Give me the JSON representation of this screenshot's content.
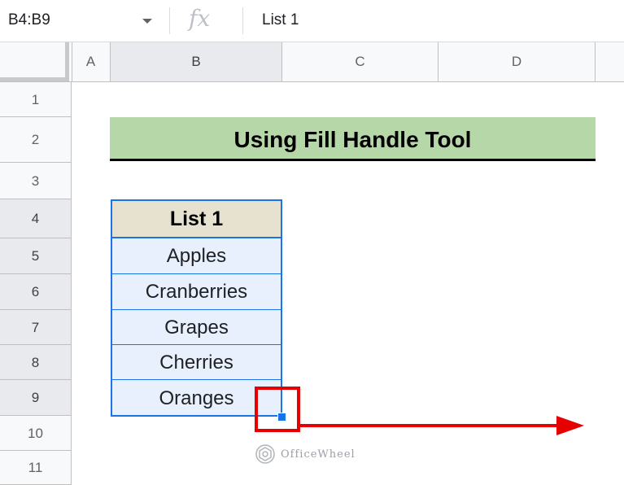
{
  "formula_bar": {
    "name_box": "B4:B9",
    "fx": "fx",
    "formula": "List 1"
  },
  "columns": [
    "A",
    "B",
    "C",
    "D"
  ],
  "rows": [
    "1",
    "2",
    "3",
    "4",
    "5",
    "6",
    "7",
    "8",
    "9",
    "10",
    "11"
  ],
  "title": "Using Fill Handle Tool",
  "list": {
    "header": "List 1",
    "items": [
      "Apples",
      "Cranberries",
      "Grapes",
      "Cherries",
      "Oranges"
    ]
  },
  "watermark": "OfficeWheel",
  "colors": {
    "title_fill": "#b6d7a8",
    "header_fill": "#e7e2d0",
    "selection_blue": "#1a73e8",
    "selection_fill": "#e8f0fe",
    "annotation_red": "#e60000"
  }
}
